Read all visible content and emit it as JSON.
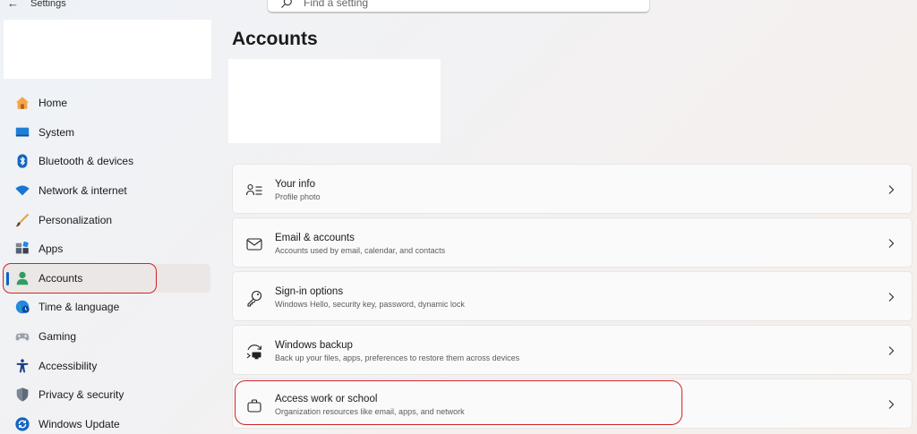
{
  "window": {
    "title": "Settings",
    "back_glyph": "←"
  },
  "search": {
    "placeholder": "Find a setting",
    "value": ""
  },
  "sidebar": {
    "items": [
      {
        "label": "Home",
        "icon": "home-icon"
      },
      {
        "label": "System",
        "icon": "system-icon"
      },
      {
        "label": "Bluetooth & devices",
        "icon": "bluetooth-icon"
      },
      {
        "label": "Network & internet",
        "icon": "wifi-icon"
      },
      {
        "label": "Personalization",
        "icon": "brush-icon"
      },
      {
        "label": "Apps",
        "icon": "apps-icon"
      },
      {
        "label": "Accounts",
        "icon": "accounts-icon",
        "selected": true
      },
      {
        "label": "Time & language",
        "icon": "globe-clock-icon"
      },
      {
        "label": "Gaming",
        "icon": "gamepad-icon"
      },
      {
        "label": "Accessibility",
        "icon": "accessibility-icon"
      },
      {
        "label": "Privacy & security",
        "icon": "shield-icon"
      },
      {
        "label": "Windows Update",
        "icon": "update-icon"
      }
    ]
  },
  "main": {
    "title": "Accounts",
    "cards": [
      {
        "title": "Your info",
        "subtitle": "Profile photo",
        "icon": "person-lines-icon"
      },
      {
        "title": "Email & accounts",
        "subtitle": "Accounts used by email, calendar, and contacts",
        "icon": "mail-icon"
      },
      {
        "title": "Sign-in options",
        "subtitle": "Windows Hello, security key, password, dynamic lock",
        "icon": "key-icon"
      },
      {
        "title": "Windows backup",
        "subtitle": "Back up your files, apps, preferences to restore them across devices",
        "icon": "backup-icon"
      },
      {
        "title": "Access work or school",
        "subtitle": "Organization resources like email, apps, and network",
        "icon": "briefcase-icon"
      }
    ]
  },
  "colors": {
    "accent": "#0a64c8",
    "annotation": "#d2232a",
    "selected_bg": "#ebe7e6"
  }
}
